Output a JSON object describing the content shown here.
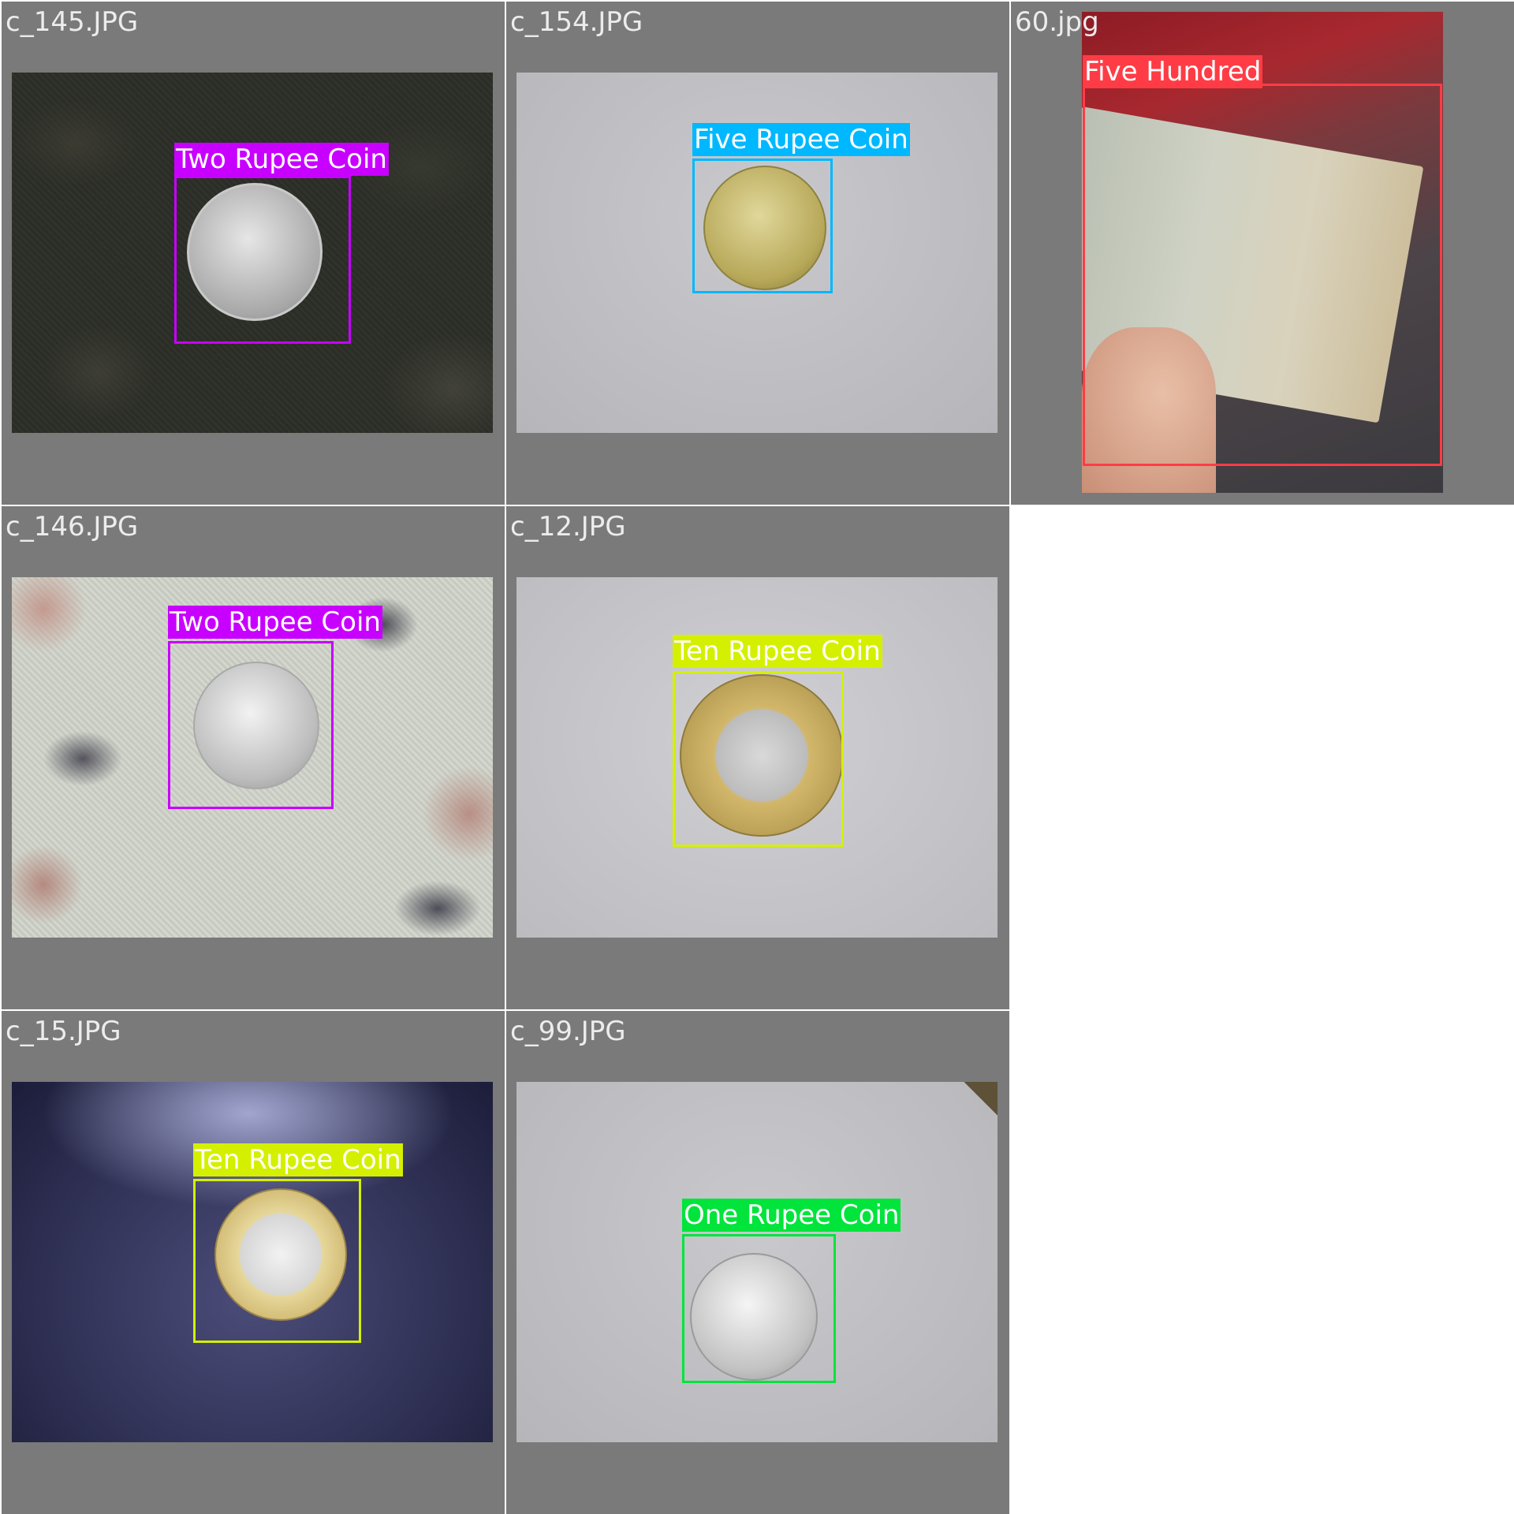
{
  "cells": [
    {
      "filename": "c_145.JPG",
      "detection": {
        "label": "Two Rupee Coin",
        "color": "#c800ff"
      }
    },
    {
      "filename": "c_154.JPG",
      "detection": {
        "label": "Five Rupee Coin",
        "color": "#00b8ff"
      }
    },
    {
      "filename": "60.jpg",
      "detection": {
        "label": "Five Hundred",
        "color": "#ff3c45"
      }
    },
    {
      "filename": "c_146.JPG",
      "detection": {
        "label": "Two Rupee Coin",
        "color": "#c800ff"
      }
    },
    {
      "filename": "c_12.JPG",
      "detection": {
        "label": "Ten Rupee Coin",
        "color": "#d4f000"
      }
    },
    {
      "filename": "c_15.JPG",
      "detection": {
        "label": "Ten Rupee Coin",
        "color": "#d4f000"
      }
    },
    {
      "filename": "c_99.JPG",
      "detection": {
        "label": "One Rupee Coin",
        "color": "#00e43c"
      }
    }
  ]
}
